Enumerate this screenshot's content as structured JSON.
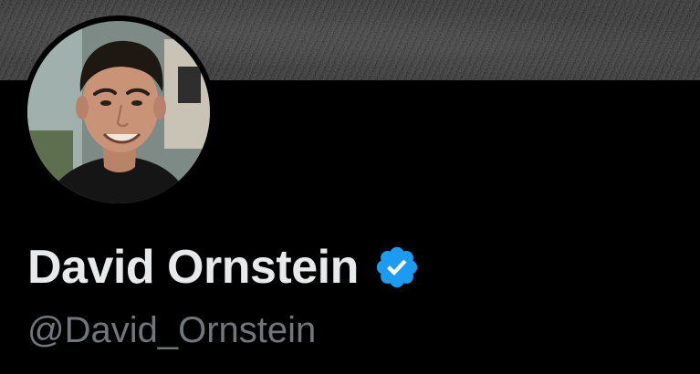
{
  "profile": {
    "display_name": "David Ornstein",
    "handle": "@David_Ornstein",
    "verified": true
  },
  "icons": {
    "verified": "verified-badge-icon"
  },
  "colors": {
    "background": "#000000",
    "name": "#e7e9ea",
    "handle": "#71767b",
    "verified_badge": "#1d9bf0"
  }
}
